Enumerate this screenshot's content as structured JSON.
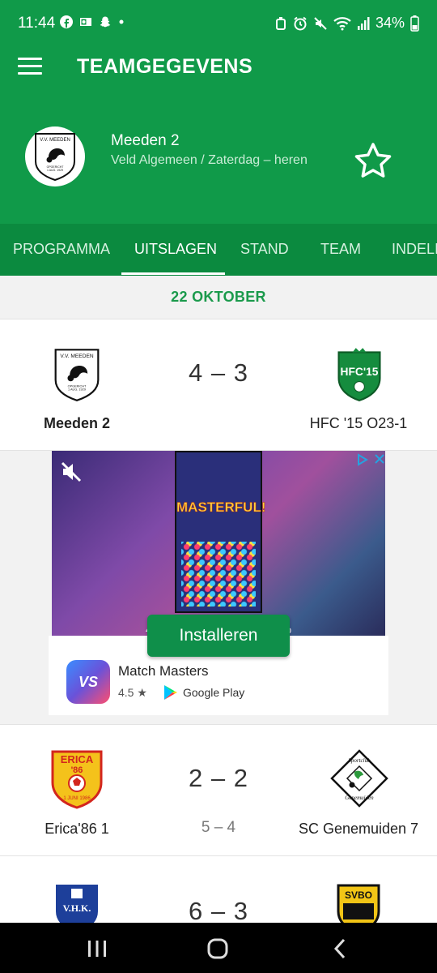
{
  "status_bar": {
    "time": "11:44",
    "left_icons": [
      "facebook-icon",
      "outlook-icon",
      "snapchat-icon",
      "dot-icon"
    ],
    "right_icons": [
      "alarm-icon",
      "clock-icon",
      "mute-icon",
      "wifi-icon",
      "signal-icon"
    ],
    "battery": "34%"
  },
  "app_bar": {
    "title": "TEAMGEGEVENS",
    "team_name": "Meeden 2",
    "team_sub": "Veld Algemeen / Zaterdag – heren"
  },
  "tabs": [
    {
      "label": "PROGRAMMA",
      "active": false
    },
    {
      "label": "UITSLAGEN",
      "active": true
    },
    {
      "label": "STAND",
      "active": false
    },
    {
      "label": "TEAM",
      "active": false
    },
    {
      "label": "INDELI",
      "active": false
    }
  ],
  "date_header": "22 OKTOBER",
  "matches": [
    {
      "home": "Meeden 2",
      "home_bold": true,
      "away": "HFC '15 O23-1",
      "score": "4 – 3",
      "penalty": ""
    },
    {
      "home": "Erica'86 1",
      "home_bold": false,
      "away": "SC Genemuiden 7",
      "score": "2 – 2",
      "penalty": "5 – 4"
    },
    {
      "home": "",
      "away": "",
      "score": "6 – 3",
      "penalty": ""
    }
  ],
  "logos": {
    "meeden_top": "V.V. MEEDEN",
    "meeden_bottom": "OPGERICHT 1 AUG. 1929",
    "hfc": "HFC'15",
    "erica_top": "ERICA",
    "erica_mid": "'86",
    "erica_bottom": "1 JUNI 1986",
    "genemuiden": "Sportclub Genemuiden",
    "vhk": "V.H.K.",
    "svbo": "SVBO"
  },
  "ad": {
    "masterful": "MASTERFUL!",
    "caption": "4 in a row will c                  opponent back up",
    "install_label": "Installeren",
    "app_name": "Match Masters",
    "app_icon_text": "VS",
    "rating": "4.5 ★",
    "store": "Google Play"
  },
  "colors": {
    "primary": "#109a49",
    "tab_bar": "#0b8a3f",
    "accent_text": "#1b9a4c"
  }
}
